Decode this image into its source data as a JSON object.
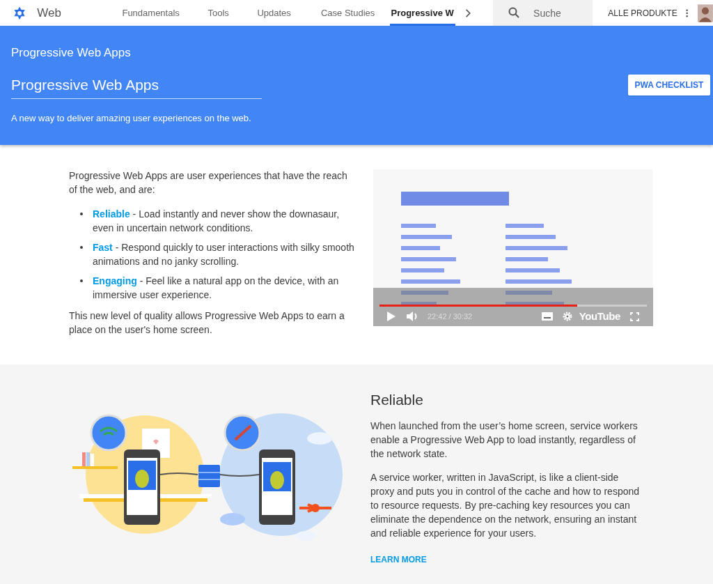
{
  "header": {
    "logo_text": "Web",
    "tabs": [
      {
        "label": "Fundamentals",
        "selected": false
      },
      {
        "label": "Tools",
        "selected": false
      },
      {
        "label": "Updates",
        "selected": false
      },
      {
        "label": "Case Studies",
        "selected": false
      },
      {
        "label": "Progressive W",
        "selected": true
      }
    ],
    "search": {
      "placeholder": "Suche"
    },
    "products_button": "ALLE PRODUKTE"
  },
  "banner": {
    "title": "Progressive Web Apps",
    "heading": "Progressive Web Apps",
    "button": "PWA CHECKLIST",
    "description": "A new way to deliver amazing user experiences on the web."
  },
  "intro": {
    "lead": "Progressive Web Apps are user experiences that have the reach of the web, and are:",
    "features": [
      {
        "term": "Reliable",
        "text": " - Load instantly and never show the downasaur, even in uncertain network conditions."
      },
      {
        "term": "Fast",
        "text": " - Respond quickly to user interactions with silky smooth animations and no janky scrolling."
      },
      {
        "term": "Engaging",
        "text": " - Feel like a natural app on the device, with an immersive user experience."
      }
    ],
    "closing": "This new level of quality allows Progressive Web Apps to earn a place on the user's home screen."
  },
  "video": {
    "kind": "picture",
    "progress": {
      "level": 0.74
    },
    "time": "22:42 / 30:32",
    "brand": "YouTube"
  },
  "reliable": {
    "heading": "Reliable",
    "paragraphs": [
      "When launched from the user’s home screen, service workers enable a Progressive Web App to load instantly, regardless of the network state.",
      "A service worker, written in JavaScript, is like a client-side proxy and puts you in control of the cache and how to respond to resource requests. By pre-caching key resources you can eliminate the dependence on the network, ensuring an instant and reliable experience for your users."
    ],
    "link": "LEARN MORE"
  }
}
